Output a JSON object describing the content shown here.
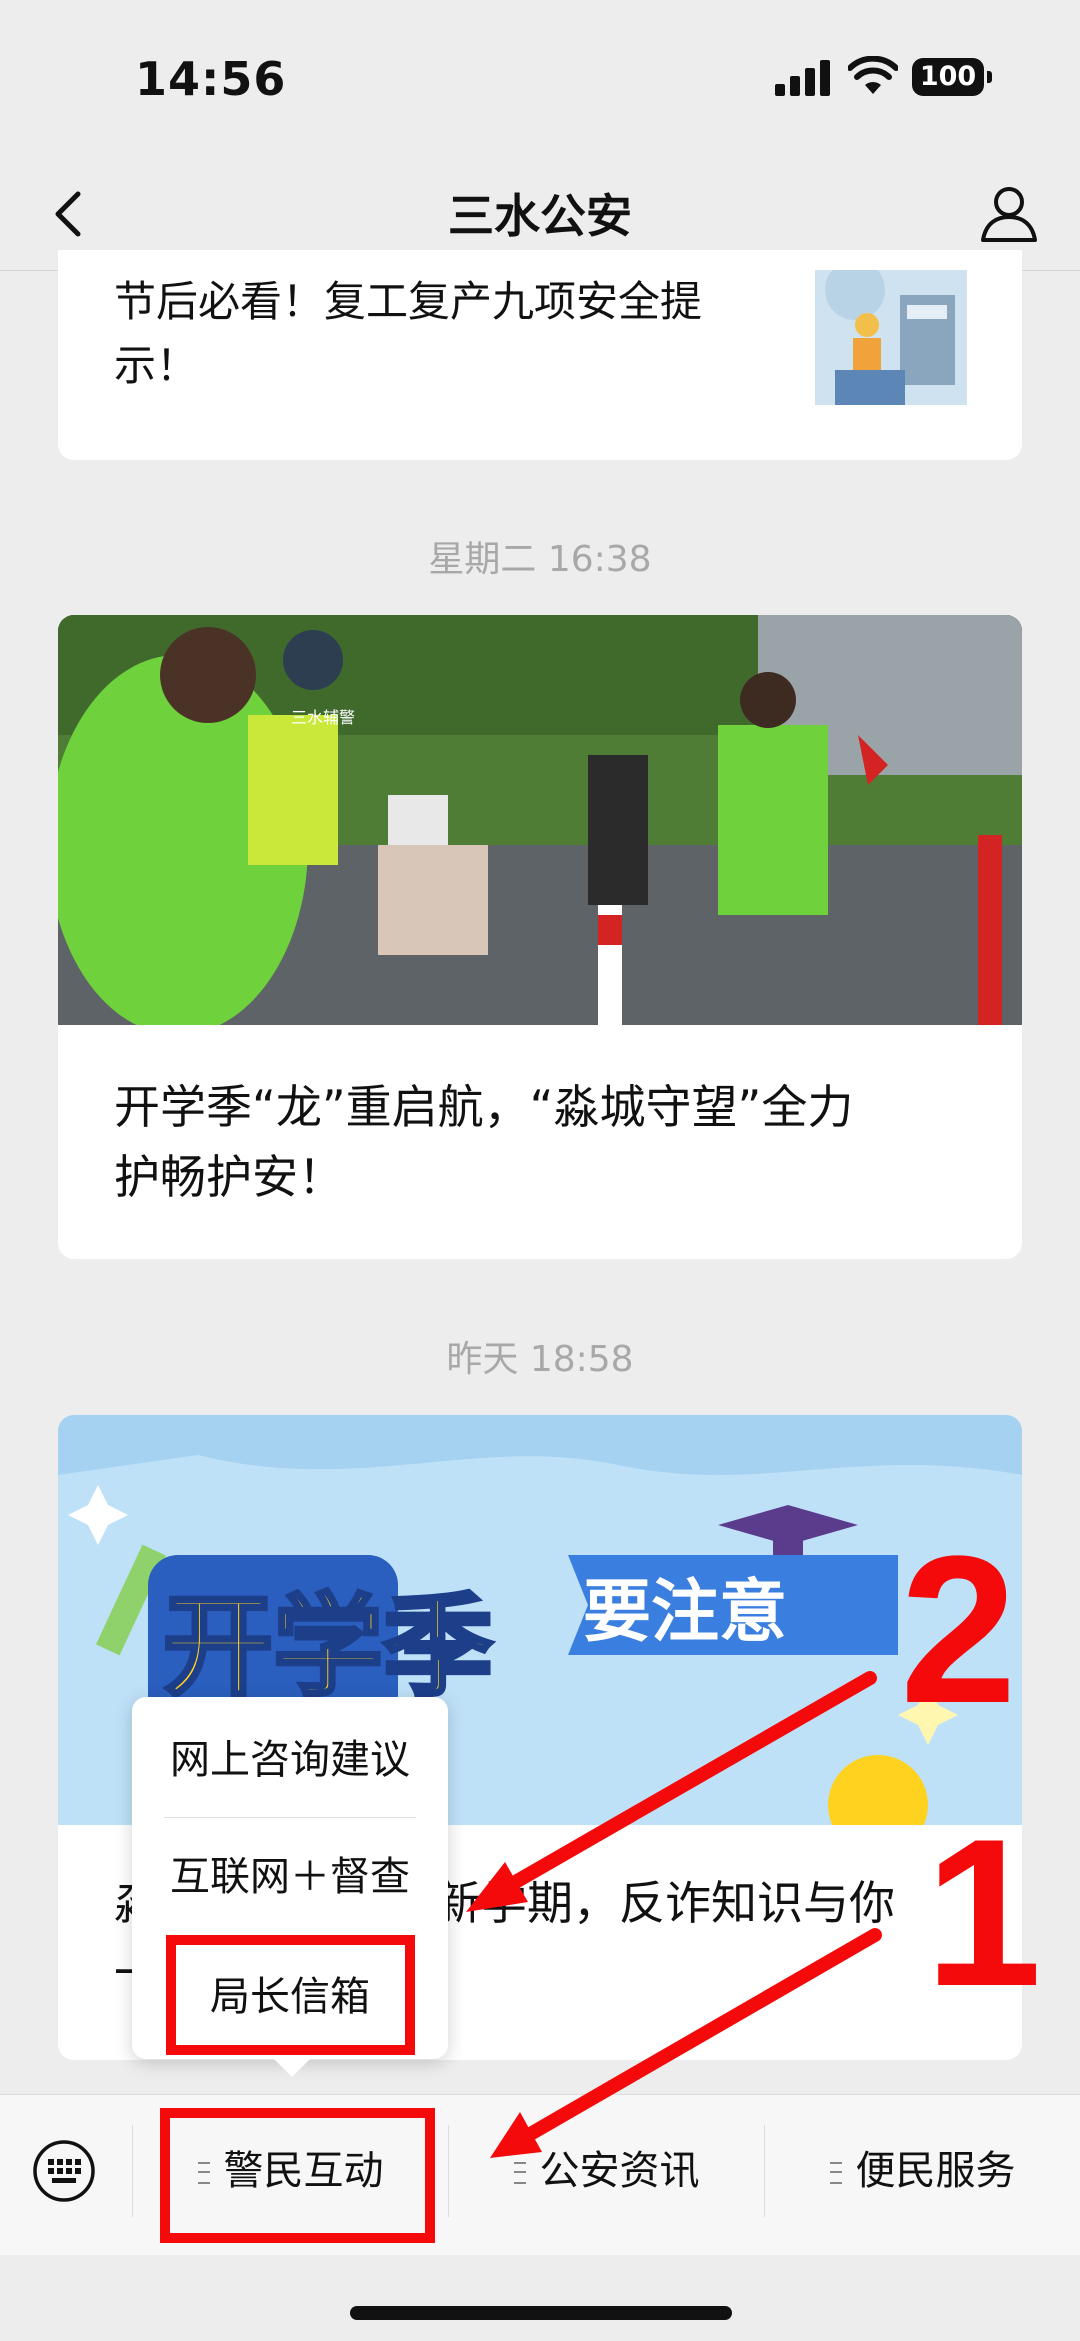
{
  "status_bar": {
    "time": "14:56",
    "battery": "100"
  },
  "nav": {
    "title": "三水公安",
    "back_icon": "chevron-left-icon",
    "profile_icon": "person-icon"
  },
  "articles": [
    {
      "title_line1": "节后必看！复工复产九项安全提",
      "title_line2": "示！"
    },
    {
      "timestamp": "星期二 16:38",
      "title_line1": "开学季“龙”重启航，“淼城守望”全力",
      "title_line2": "护畅护安！",
      "photo_vest_text": "三水辅警"
    },
    {
      "timestamp": "昨天 18:58",
      "title_line1": "淼",
      "title_line1_tail": "新学期，反诈知识与你",
      "title_line2": "一",
      "banner_text_a": "开学季",
      "banner_text_b": "要注意"
    }
  ],
  "popup_menu": {
    "items": [
      "网上咨询建议",
      "互联网＋督查",
      "局长信箱"
    ]
  },
  "tabbar": {
    "keyboard_icon": "keyboard-icon",
    "tabs": [
      "警民互动",
      "公安资讯",
      "便民服务"
    ]
  },
  "annotations": {
    "step1": "1",
    "step2": "2",
    "color": "#f40a0a"
  }
}
